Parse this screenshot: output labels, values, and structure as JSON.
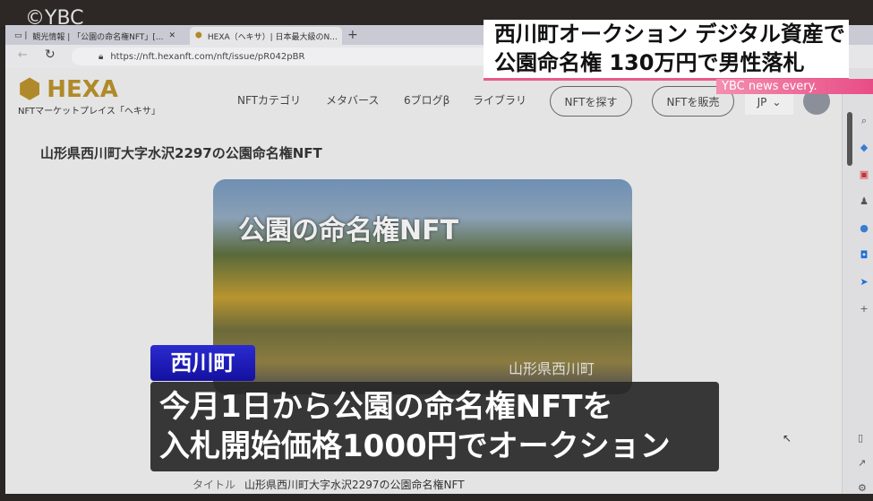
{
  "watermark": "©YBC",
  "browser": {
    "tabs": [
      {
        "label": "観光情報 | 「公園の命名権NFT」[..."
      },
      {
        "label": "HEXA（ヘキサ）| 日本最大級のN..."
      }
    ],
    "url": "https://nft.hexanft.com/nft/issue/pR042pBR"
  },
  "site": {
    "logo": "HEXA",
    "tagline": "NFTマーケットプレイス「ヘキサ」",
    "nav": [
      "NFTカテゴリ",
      "メタバース",
      "6ブログβ",
      "ライブラリ"
    ],
    "find_button": "NFTを探す",
    "sell_button": "NFTを販売",
    "lang": "JP"
  },
  "page": {
    "heading": "山形県西川町大字水沢2297の公園命名権NFT",
    "image_title": "公園の命名権NFT",
    "image_caption": "山形県西川町",
    "title_label": "タイトル",
    "title_value": "山形県西川町大字水沢2297の公園命名権NFT"
  },
  "news": {
    "headline_1": "西川町オークション デジタル資産で",
    "headline_2": "公園命名権 130万円で男性落札",
    "brand": "YBC news every.",
    "location": "西川町",
    "subtitle_1": "今月1日から公園の命名権NFTを",
    "subtitle_2": "入札開始価格1000円でオークション"
  }
}
